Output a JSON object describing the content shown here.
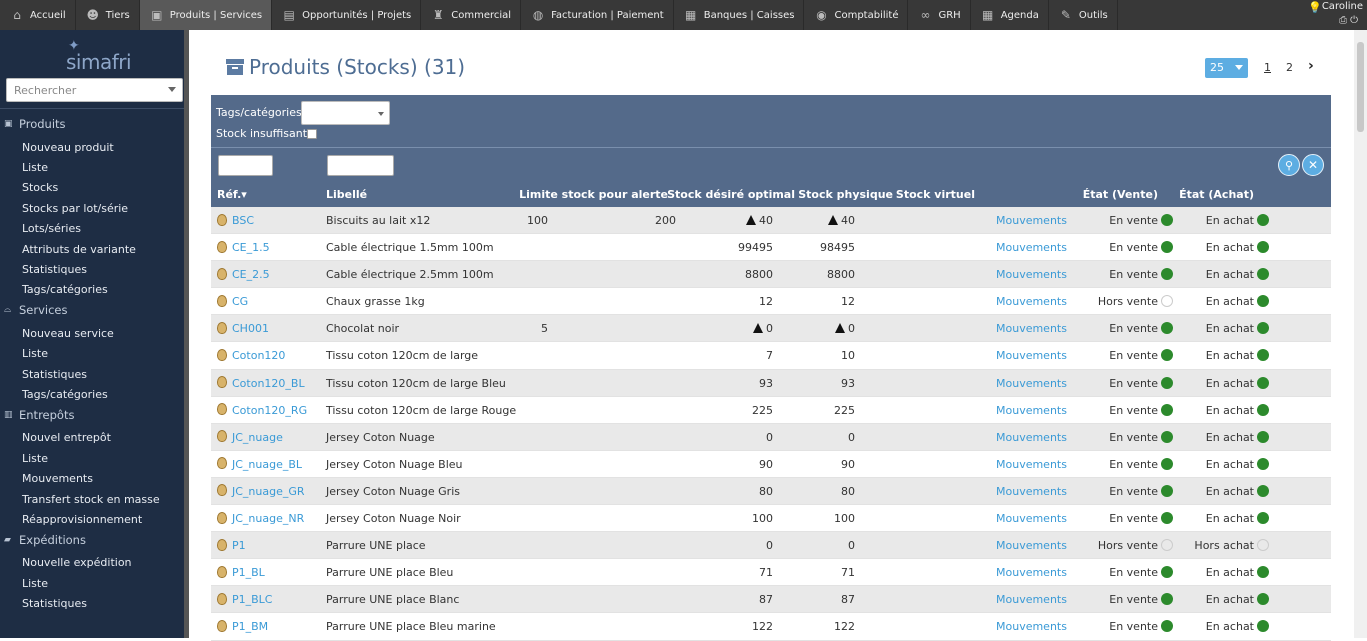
{
  "topnav": [
    {
      "icon": "home-icon",
      "label": "Accueil",
      "active": false
    },
    {
      "icon": "users-icon",
      "label": "Tiers",
      "active": false
    },
    {
      "icon": "box-icon",
      "label": "Produits | Services",
      "active": true
    },
    {
      "icon": "briefcase-icon",
      "label": "Opportunités | Projets",
      "active": false
    },
    {
      "icon": "trophy-icon",
      "label": "Commercial",
      "active": false
    },
    {
      "icon": "piggy-bank-icon",
      "label": "Facturation | Paiement",
      "active": false
    },
    {
      "icon": "bank-icon",
      "label": "Banques | Caisses",
      "active": false
    },
    {
      "icon": "coins-icon",
      "label": "Comptabilité",
      "active": false
    },
    {
      "icon": "binoculars-icon",
      "label": "GRH",
      "active": false
    },
    {
      "icon": "calendar-icon",
      "label": "Agenda",
      "active": false
    },
    {
      "icon": "tools-icon",
      "label": "Outils",
      "active": false
    }
  ],
  "user": {
    "name": "Caroline"
  },
  "logo": {
    "text": "simafri"
  },
  "search": {
    "placeholder": "Rechercher"
  },
  "sidebar": [
    {
      "title": "Produits",
      "icon": "box-icon",
      "items": [
        "Nouveau produit",
        "Liste",
        "Stocks",
        "Stocks par lot/série",
        "Lots/séries",
        "Attributs de variante",
        "Statistiques",
        "Tags/catégories"
      ]
    },
    {
      "title": "Services",
      "icon": "service-icon",
      "items": [
        "Nouveau service",
        "Liste",
        "Statistiques",
        "Tags/catégories"
      ]
    },
    {
      "title": "Entrepôts",
      "icon": "warehouse-icon",
      "items": [
        "Nouvel entrepôt",
        "Liste",
        "Mouvements",
        "Transfert stock en masse",
        "Réapprovisionnement"
      ]
    },
    {
      "title": "Expéditions",
      "icon": "truck-icon",
      "items": [
        "Nouvelle expédition",
        "Liste",
        "Statistiques"
      ]
    }
  ],
  "page": {
    "title": "Produits (Stocks) (31)",
    "per_page": "25",
    "pages": [
      "1",
      "2"
    ],
    "next": "›"
  },
  "filters": {
    "tags_label": "Tags/catégories:",
    "stock_label": "Stock insuffisant"
  },
  "columns": {
    "ref": "Réf.▾",
    "label": "Libellé",
    "limit": "Limite stock pour alerte",
    "desired": "Stock désiré optimal",
    "physical": "Stock physique",
    "virtual": "Stock virtuel",
    "sale": "État (Vente)",
    "buy": "État (Achat)"
  },
  "rows": [
    {
      "ref": "BSC",
      "label": "Biscuits au lait x12",
      "limit": "100",
      "desired": "200",
      "physical": "40",
      "virtual": "40",
      "warn": true,
      "movements": "Mouvements",
      "sale": "En vente",
      "sale_on": true,
      "buy": "En achat",
      "buy_on": true
    },
    {
      "ref": "CE_1.5",
      "label": "Cable électrique 1.5mm 100m",
      "limit": "",
      "desired": "",
      "physical": "99495",
      "virtual": "98495",
      "warn": false,
      "movements": "Mouvements",
      "sale": "En vente",
      "sale_on": true,
      "buy": "En achat",
      "buy_on": true
    },
    {
      "ref": "CE_2.5",
      "label": "Cable électrique 2.5mm 100m",
      "limit": "",
      "desired": "",
      "physical": "8800",
      "virtual": "8800",
      "warn": false,
      "movements": "Mouvements",
      "sale": "En vente",
      "sale_on": true,
      "buy": "En achat",
      "buy_on": true
    },
    {
      "ref": "CG",
      "label": "Chaux grasse 1kg",
      "limit": "",
      "desired": "",
      "physical": "12",
      "virtual": "12",
      "warn": false,
      "movements": "Mouvements",
      "sale": "Hors vente",
      "sale_on": false,
      "buy": "En achat",
      "buy_on": true
    },
    {
      "ref": "CH001",
      "label": "Chocolat noir",
      "limit": "5",
      "desired": "",
      "physical": "0",
      "virtual": "0",
      "warn": true,
      "movements": "Mouvements",
      "sale": "En vente",
      "sale_on": true,
      "buy": "En achat",
      "buy_on": true
    },
    {
      "ref": "Coton120",
      "label": "Tissu coton 120cm de large",
      "limit": "",
      "desired": "",
      "physical": "7",
      "virtual": "10",
      "warn": false,
      "movements": "Mouvements",
      "sale": "En vente",
      "sale_on": true,
      "buy": "En achat",
      "buy_on": true
    },
    {
      "ref": "Coton120_BL",
      "label": "Tissu coton 120cm de large Bleu",
      "limit": "",
      "desired": "",
      "physical": "93",
      "virtual": "93",
      "warn": false,
      "movements": "Mouvements",
      "sale": "En vente",
      "sale_on": true,
      "buy": "En achat",
      "buy_on": true
    },
    {
      "ref": "Coton120_RG",
      "label": "Tissu coton 120cm de large Rouge",
      "limit": "",
      "desired": "",
      "physical": "225",
      "virtual": "225",
      "warn": false,
      "movements": "Mouvements",
      "sale": "En vente",
      "sale_on": true,
      "buy": "En achat",
      "buy_on": true
    },
    {
      "ref": "JC_nuage",
      "label": "Jersey Coton Nuage",
      "limit": "",
      "desired": "",
      "physical": "0",
      "virtual": "0",
      "warn": false,
      "movements": "Mouvements",
      "sale": "En vente",
      "sale_on": true,
      "buy": "En achat",
      "buy_on": true
    },
    {
      "ref": "JC_nuage_BL",
      "label": "Jersey Coton Nuage Bleu",
      "limit": "",
      "desired": "",
      "physical": "90",
      "virtual": "90",
      "warn": false,
      "movements": "Mouvements",
      "sale": "En vente",
      "sale_on": true,
      "buy": "En achat",
      "buy_on": true
    },
    {
      "ref": "JC_nuage_GR",
      "label": "Jersey Coton Nuage Gris",
      "limit": "",
      "desired": "",
      "physical": "80",
      "virtual": "80",
      "warn": false,
      "movements": "Mouvements",
      "sale": "En vente",
      "sale_on": true,
      "buy": "En achat",
      "buy_on": true
    },
    {
      "ref": "JC_nuage_NR",
      "label": "Jersey Coton Nuage Noir",
      "limit": "",
      "desired": "",
      "physical": "100",
      "virtual": "100",
      "warn": false,
      "movements": "Mouvements",
      "sale": "En vente",
      "sale_on": true,
      "buy": "En achat",
      "buy_on": true
    },
    {
      "ref": "P1",
      "label": "Parrure UNE place",
      "limit": "",
      "desired": "",
      "physical": "0",
      "virtual": "0",
      "warn": false,
      "movements": "Mouvements",
      "sale": "Hors vente",
      "sale_on": false,
      "buy": "Hors achat",
      "buy_on": false
    },
    {
      "ref": "P1_BL",
      "label": "Parrure UNE place Bleu",
      "limit": "",
      "desired": "",
      "physical": "71",
      "virtual": "71",
      "warn": false,
      "movements": "Mouvements",
      "sale": "En vente",
      "sale_on": true,
      "buy": "En achat",
      "buy_on": true
    },
    {
      "ref": "P1_BLC",
      "label": "Parrure UNE place Blanc",
      "limit": "",
      "desired": "",
      "physical": "87",
      "virtual": "87",
      "warn": false,
      "movements": "Mouvements",
      "sale": "En vente",
      "sale_on": true,
      "buy": "En achat",
      "buy_on": true
    },
    {
      "ref": "P1_BM",
      "label": "Parrure UNE place Bleu marine",
      "limit": "",
      "desired": "",
      "physical": "122",
      "virtual": "122",
      "warn": false,
      "movements": "Mouvements",
      "sale": "En vente",
      "sale_on": true,
      "buy": "En achat",
      "buy_on": true
    }
  ],
  "colors": {
    "topbar": "#383838",
    "sidebar": "#1e2d44",
    "header_band": "#546a8a",
    "link": "#3a9ad6",
    "status_on": "#2c8a2c",
    "title": "#4e6d93"
  }
}
